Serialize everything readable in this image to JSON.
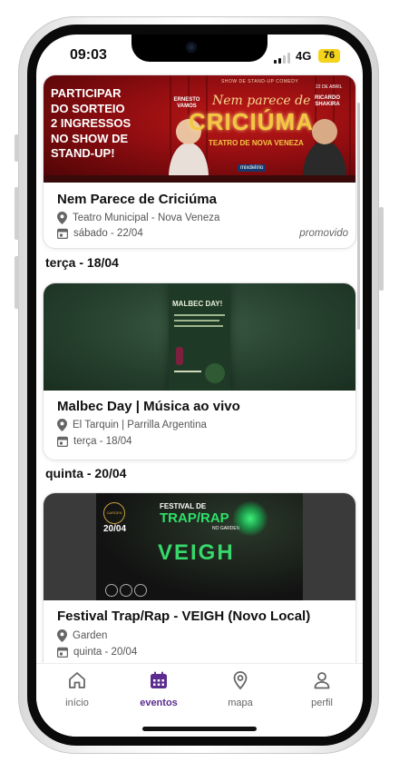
{
  "status_bar": {
    "time": "09:03",
    "network": "4G",
    "battery": "76"
  },
  "events": [
    {
      "title": "Nem Parece de Criciúma",
      "venue": "Teatro Municipal - Nova Veneza",
      "date": "sábado - 22/04",
      "badge": "promovido",
      "banner": {
        "headline": [
          "PARTICIPAR",
          "DO SORTEIO",
          "2 INGRESSOS",
          "NO SHOW DE",
          "STAND-UP!"
        ],
        "show_label": "SHOW DE STAND-UP COMEDY",
        "script_title": "Nem parece de",
        "main_title": "CRICIÚMA",
        "performer_left": "ERNESTO VAMOS",
        "performer_right": "RICARDO SHAKIRA",
        "venue_line": "TEATRO DE NOVA VENEZA",
        "date_line": "22 DE ABRIL",
        "sponsor": "mixdelirio"
      }
    },
    {
      "section": "terça - 18/04",
      "title": "Malbec Day | Música ao vivo",
      "venue": "El Tarquin | Parrilla Argentina",
      "date": "terça - 18/04",
      "banner": {
        "poster_title": "MALBEC DAY!"
      }
    },
    {
      "section": "quinta - 20/04",
      "title": "Festival Trap/Rap - VEIGH (Novo Local)",
      "venue": "Garden",
      "date": "quinta - 20/04",
      "banner": {
        "line1": "FESTIVAL DE",
        "line2": "TRAP/RAP",
        "line3": "NO GARDEN",
        "artist": "VEIGH",
        "date_tag": "20/04",
        "logo": "GARDEN"
      }
    }
  ],
  "tabs": [
    {
      "label": "início",
      "icon": "home-icon"
    },
    {
      "label": "eventos",
      "icon": "calendar-icon",
      "active": true
    },
    {
      "label": "mapa",
      "icon": "map-pin-icon"
    },
    {
      "label": "perfil",
      "icon": "user-icon"
    }
  ],
  "colors": {
    "accent": "#5b2b8f",
    "battery": "#f4d31c",
    "banner_red": "#8f0d10",
    "banner_green": "#1f3d27"
  }
}
